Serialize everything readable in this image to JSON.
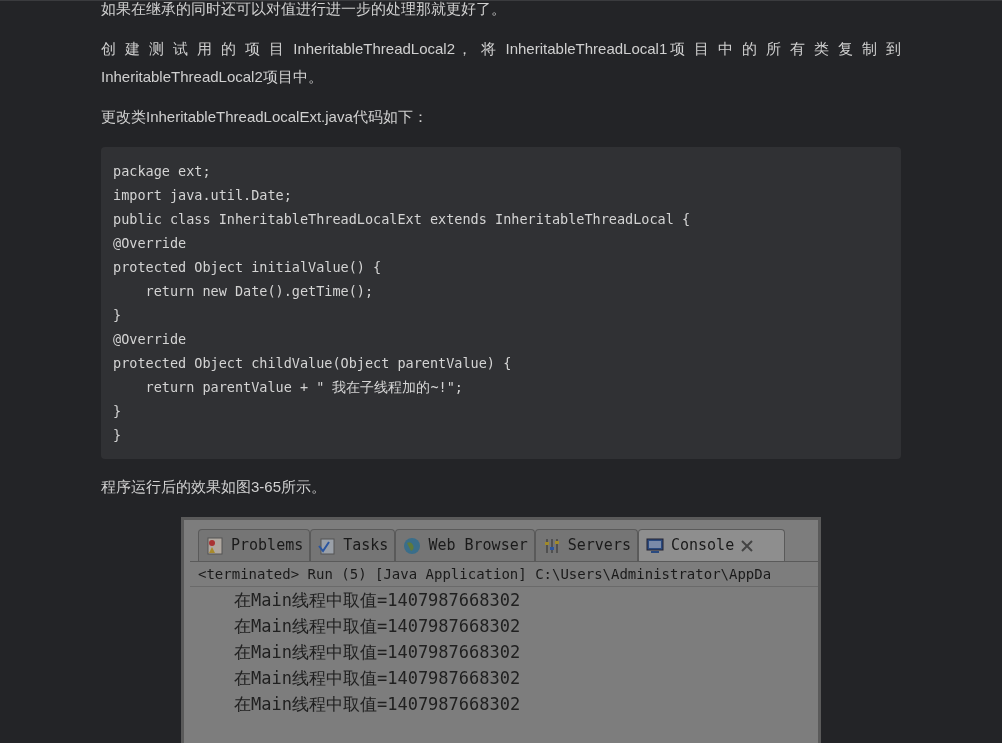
{
  "paragraphs": [
    "如果在继承的同时还可以对值进行进一步的处理那就更好了。",
    "创 建 测 试 用 的 项 目 InheritableThreadLocal2， 将 InheritableThreadLocal1项 目 中 的 所 有 类 复 制 到 InheritableThreadLocal2项目中。",
    "更改类InheritableThreadLocalExt.java代码如下："
  ],
  "code": [
    "package ext;",
    "import java.util.Date;",
    "public class InheritableThreadLocalExt extends InheritableThreadLocal {",
    "@Override",
    "protected Object initialValue() {",
    "    return new Date().getTime();",
    "}",
    "@Override",
    "protected Object childValue(Object parentValue) {",
    "    return parentValue + \" 我在子线程加的~!\";",
    "}",
    "}"
  ],
  "caption": "程序运行后的效果如图3-65所示。",
  "console": {
    "tabs": [
      {
        "label": "Problems",
        "kind": "problems",
        "selected": false
      },
      {
        "label": "Tasks",
        "kind": "tasks",
        "selected": false
      },
      {
        "label": "Web Browser",
        "kind": "browser",
        "selected": false
      },
      {
        "label": "Servers",
        "kind": "servers",
        "selected": false
      },
      {
        "label": "Console",
        "kind": "console",
        "selected": true
      }
    ],
    "status": "<terminated> Run (5) [Java Application] C:\\Users\\Administrator\\AppDa",
    "lines": [
      "在Main线程中取值=1407987668302",
      "在Main线程中取值=1407987668302",
      "在Main线程中取值=1407987668302",
      "在Main线程中取值=1407987668302",
      "在Main线程中取值=1407987668302"
    ]
  }
}
